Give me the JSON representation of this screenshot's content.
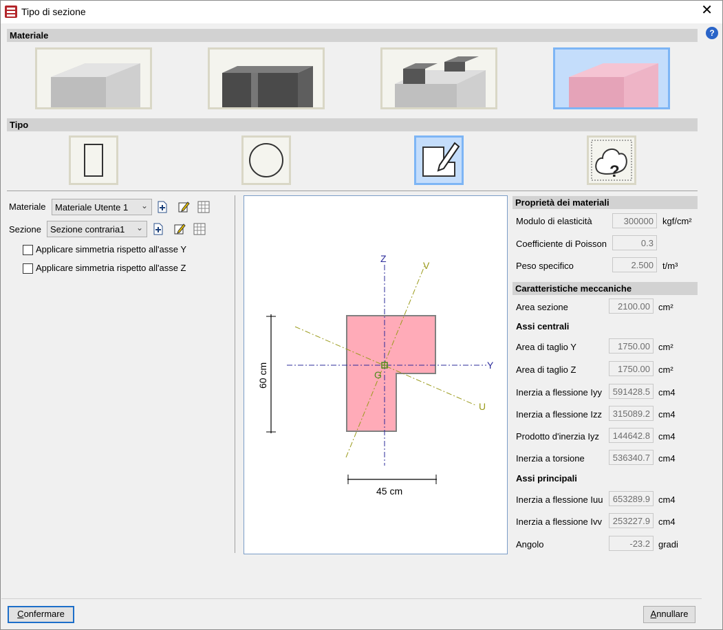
{
  "window": {
    "title": "Tipo di sezione",
    "close_label": "✕",
    "help_label": "?"
  },
  "sections": {
    "materiale": "Materiale",
    "tipo": "Tipo"
  },
  "material_tiles": [
    {
      "name": "concrete",
      "selected": false
    },
    {
      "name": "steel",
      "selected": false
    },
    {
      "name": "mixed",
      "selected": false
    },
    {
      "name": "generic",
      "selected": true
    }
  ],
  "type_tiles": [
    {
      "name": "rectangle",
      "selected": false
    },
    {
      "name": "circle",
      "selected": false
    },
    {
      "name": "custom-drawn",
      "selected": true
    },
    {
      "name": "import",
      "selected": false
    }
  ],
  "left_panel": {
    "materiale_label": "Materiale",
    "materiale_value": "Materiale Utente 1",
    "sezione_label": "Sezione",
    "sezione_value": "Sezione contraria1",
    "chk_y": "Applicare simmetria rispetto all'asse Y",
    "chk_z": "Applicare simmetria rispetto all'asse Z",
    "chk_y_checked": false,
    "chk_z_checked": false
  },
  "drawing": {
    "axis_z": "Z",
    "axis_y": "Y",
    "axis_v": "V",
    "axis_u": "U",
    "centroid": "G",
    "dim_height": "60 cm",
    "dim_width": "45 cm",
    "fill_color": "#ffabb8",
    "axis_color": "#2a2a9a",
    "principal_color": "#9a9a1a"
  },
  "properties": {
    "materials_header": "Proprietà dei materiali",
    "modulo_label": "Modulo di elasticità",
    "modulo_value": "300000",
    "modulo_unit": "kgf/cm²",
    "poisson_label": "Coefficiente di Poisson",
    "poisson_value": "0.3",
    "peso_label": "Peso specifico",
    "peso_value": "2.500",
    "peso_unit": "t/m³",
    "mech_header": "Caratteristiche meccaniche",
    "area_label": "Area sezione",
    "area_value": "2100.00",
    "area_unit": "cm²",
    "assi_centrali": "Assi centrali",
    "taglio_y_label": "Area di taglio Y",
    "taglio_y_value": "1750.00",
    "taglio_y_unit": "cm²",
    "taglio_z_label": "Area di taglio Z",
    "taglio_z_value": "1750.00",
    "taglio_z_unit": "cm²",
    "iyy_label": "Inerzia a flessione Iyy",
    "iyy_value": "591428.5",
    "iyy_unit": "cm4",
    "izz_label": "Inerzia a flessione Izz",
    "izz_value": "315089.2",
    "izz_unit": "cm4",
    "iyz_label": "Prodotto d'inerzia Iyz",
    "iyz_value": "144642.8",
    "iyz_unit": "cm4",
    "tors_label": "Inerzia a torsione",
    "tors_value": "536340.7",
    "tors_unit": "cm4",
    "assi_principali": "Assi principali",
    "iuu_label": "Inerzia a flessione Iuu",
    "iuu_value": "653289.9",
    "iuu_unit": "cm4",
    "ivv_label": "Inerzia a flessione Ivv",
    "ivv_value": "253227.9",
    "ivv_unit": "cm4",
    "angolo_label": "Angolo",
    "angolo_value": "-23.2",
    "angolo_unit": "gradi"
  },
  "footer": {
    "confirm_first": "C",
    "confirm_rest": "onfermare",
    "cancel_first": "A",
    "cancel_rest": "nnullare"
  }
}
